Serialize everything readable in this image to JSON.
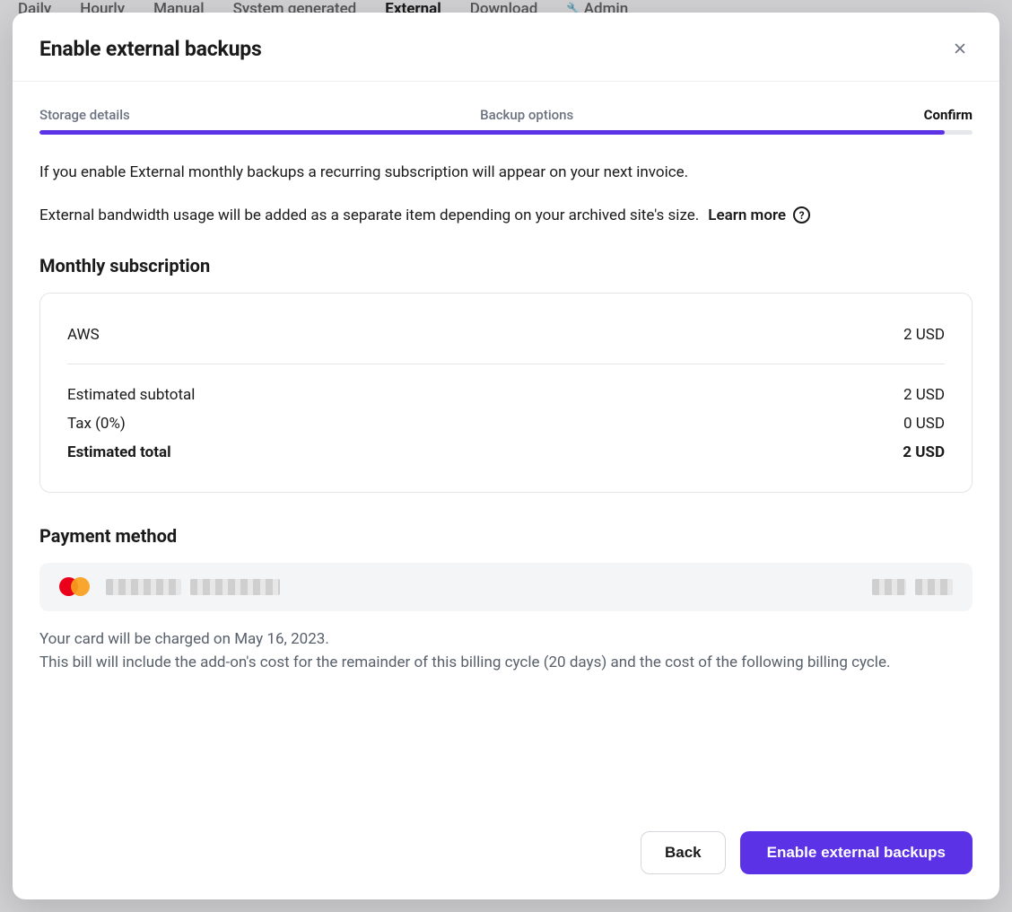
{
  "bg_tabs": {
    "items": [
      "Daily",
      "Hourly",
      "Manual",
      "System generated",
      "External",
      "Download",
      "Admin"
    ],
    "active_index": 4
  },
  "modal": {
    "title": "Enable external backups",
    "steps": {
      "a": "Storage details",
      "b": "Backup options",
      "c": "Confirm"
    },
    "intro1": "If you enable External monthly backups a recurring subscription will appear on your next invoice.",
    "intro2": "External bandwidth usage will be added as a separate item depending on your archived site's size.",
    "learn_more": "Learn more",
    "subscription_heading": "Monthly subscription",
    "summary": {
      "line_item_label": "AWS",
      "line_item_value": "2 USD",
      "subtotal_label": "Estimated subtotal",
      "subtotal_value": "2 USD",
      "tax_label": "Tax (0%)",
      "tax_value": "0 USD",
      "total_label": "Estimated total",
      "total_value": "2 USD"
    },
    "payment_heading": "Payment method",
    "charge_note_line1": "Your card will be charged on May 16, 2023.",
    "charge_note_line2": "This bill will include the add-on's cost for the remainder of this billing cycle (20 days) and the cost of the following billing cycle.",
    "footer": {
      "back": "Back",
      "submit": "Enable external backups"
    }
  }
}
